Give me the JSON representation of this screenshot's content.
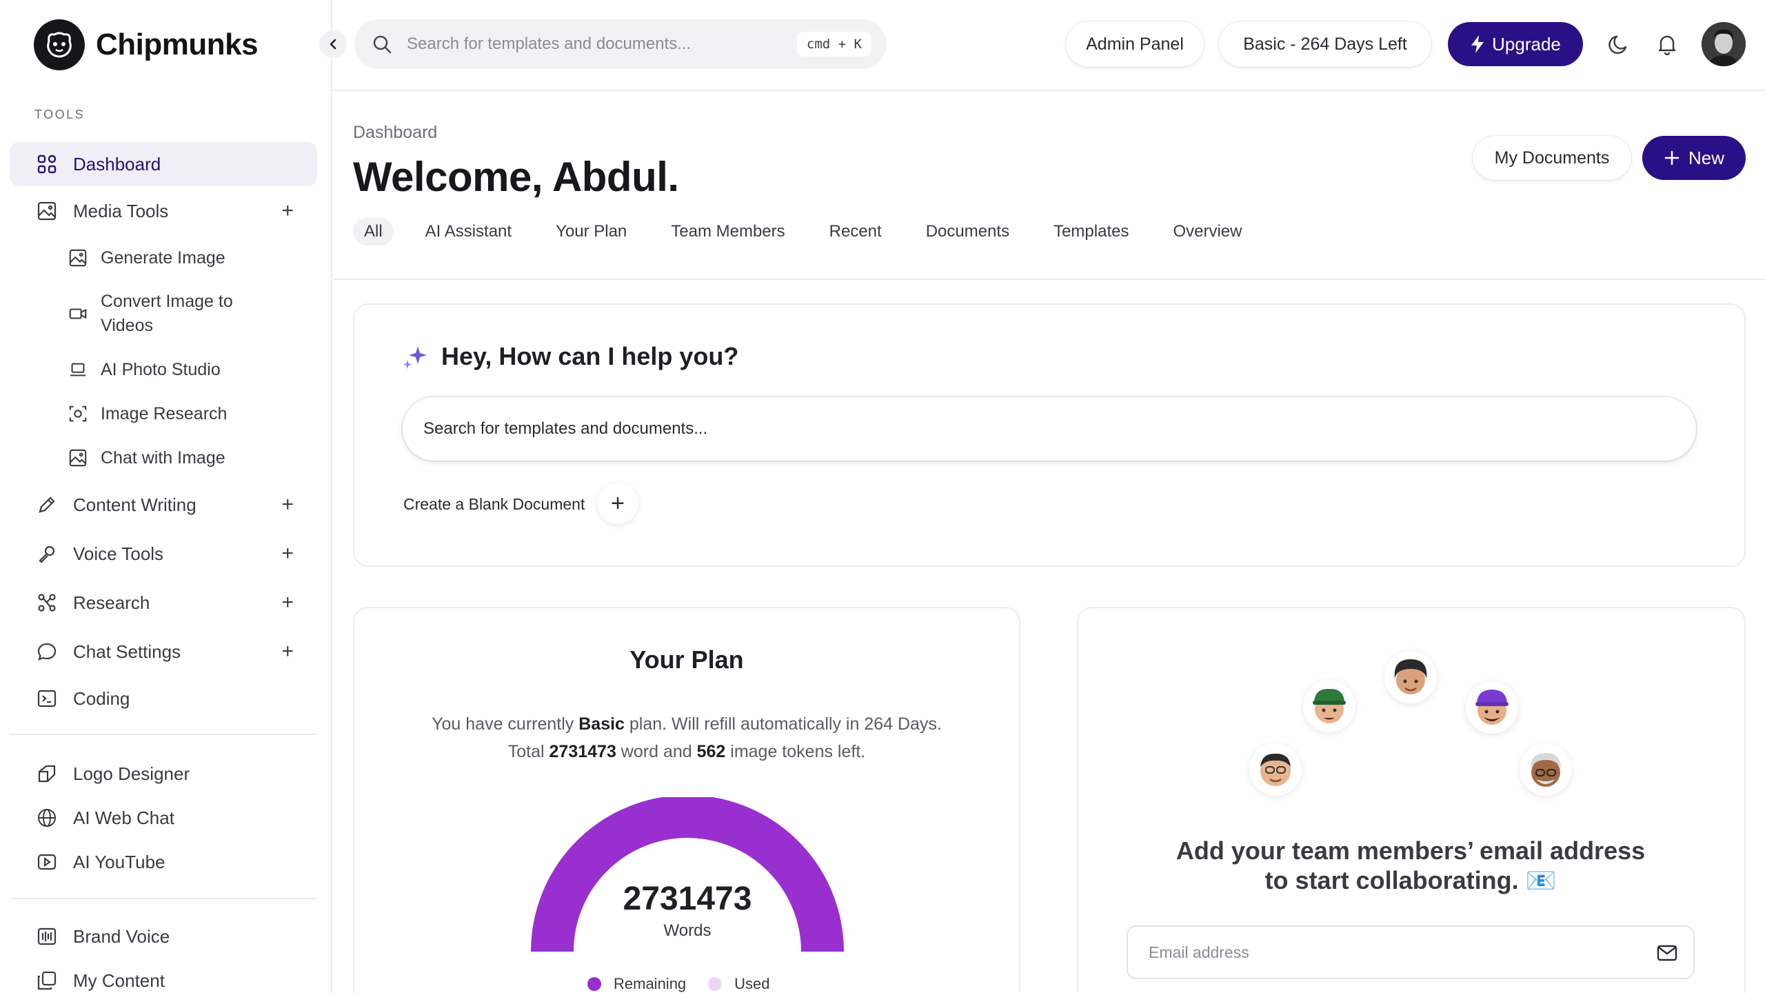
{
  "app": {
    "name": "Chipmunks"
  },
  "sidebar": {
    "section_label": "TOOLS",
    "items": [
      {
        "label": "Dashboard",
        "icon": "grid-icon"
      },
      {
        "label": "Media Tools",
        "icon": "image-icon"
      },
      {
        "label": "Content Writing",
        "icon": "pencil-icon"
      },
      {
        "label": "Voice Tools",
        "icon": "microphone-icon"
      },
      {
        "label": "Research",
        "icon": "network-icon"
      },
      {
        "label": "Chat Settings",
        "icon": "chat-bubble-icon"
      },
      {
        "label": "Coding",
        "icon": "terminal-icon"
      },
      {
        "label": "Logo Designer",
        "icon": "logo-icon"
      },
      {
        "label": "AI Web Chat",
        "icon": "globe-icon"
      },
      {
        "label": "AI YouTube",
        "icon": "play-icon"
      },
      {
        "label": "Brand Voice",
        "icon": "waveform-icon"
      },
      {
        "label": "My Content",
        "icon": "copy-icon"
      }
    ],
    "media_sub": [
      {
        "label": "Generate Image",
        "icon": "image-icon"
      },
      {
        "label": "Convert Image to Videos",
        "icon": "video-icon"
      },
      {
        "label": "AI Photo Studio",
        "icon": "laptop-icon"
      },
      {
        "label": "Image Research",
        "icon": "scan-icon"
      },
      {
        "label": "Chat with Image",
        "icon": "image-icon"
      }
    ]
  },
  "topbar": {
    "search_placeholder": "Search for templates and documents...",
    "shortcut": "cmd + K",
    "admin_panel": "Admin Panel",
    "plan_badge": "Basic - 264 Days Left",
    "upgrade": "Upgrade"
  },
  "header": {
    "breadcrumb": "Dashboard",
    "welcome": "Welcome, Abdul.",
    "my_documents": "My Documents",
    "new_button": "New",
    "tabs": [
      "All",
      "AI Assistant",
      "Your Plan",
      "Team Members",
      "Recent",
      "Documents",
      "Templates",
      "Overview"
    ]
  },
  "help_card": {
    "title": "Hey, How can I help you?",
    "input_placeholder": "Search for templates and documents...",
    "blank_doc": "Create a Blank Document"
  },
  "plan_card": {
    "title": "Your Plan",
    "line1_pre": "You have currently ",
    "plan_name": "Basic",
    "line1_post": " plan. Will refill automatically in 264 Days.",
    "line2_pre": "Total ",
    "words_left": "2731473",
    "line2_mid": " word and ",
    "images_left": "562",
    "line2_post": " image tokens left.",
    "gauge_value": "2731473",
    "gauge_label": "Words",
    "remaining_fraction": 1.0,
    "legend": [
      {
        "label": "Remaining",
        "color": "#9a2fd0"
      },
      {
        "label": "Used",
        "color": "#ecd6f6"
      }
    ]
  },
  "team_card": {
    "text_line1": "Add your team members’ email address",
    "text_line2": "to start collaborating. 📧",
    "email_placeholder": "Email address"
  },
  "colors": {
    "accent": "#2a0f86",
    "gauge": "#9a2fd0",
    "active_nav_bg": "#f0eff7"
  }
}
